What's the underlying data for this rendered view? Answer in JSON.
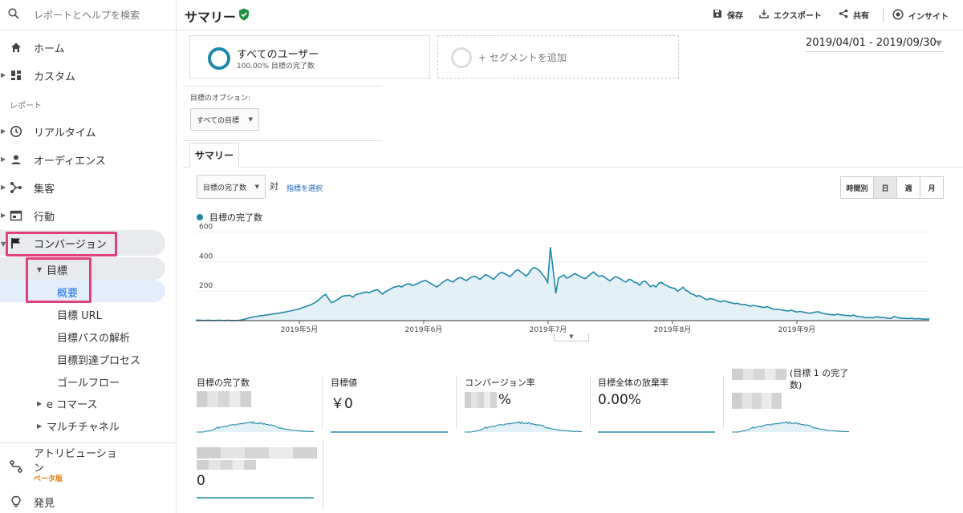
{
  "sidebar": {
    "search_placeholder": "レポートとヘルプを検索",
    "home": "ホーム",
    "custom": "カスタム",
    "reports_section": "レポート",
    "realtime": "リアルタイム",
    "audience": "オーディエンス",
    "acquisition": "集客",
    "behavior": "行動",
    "conversions": "コンバージョン",
    "goals": "目標",
    "overview": "概要",
    "goal_url": "目標 URL",
    "reverse_goal_path": "目標パスの解析",
    "funnel": "目標到達プロセス",
    "goal_flow": "ゴールフロー",
    "ecommerce": "e コマース",
    "multichannel": "マルチチャネル",
    "attribution": "アトリビューション",
    "beta": "ベータ版",
    "discover": "発見"
  },
  "topbar": {
    "title": "サマリー",
    "save": "保存",
    "export": "エクスポート",
    "share": "共有",
    "insights": "インサイト"
  },
  "segments": {
    "all_users": "すべてのユーザー",
    "all_users_sub": "100.00% 目標の完了数",
    "add_segment": "+ セグメントを追加"
  },
  "date_range": "2019/04/01 - 2019/09/30",
  "goal_options": {
    "label": "目標のオプション:",
    "selected": "すべての目標"
  },
  "tab": "サマリー",
  "metric_selector": {
    "selected": "目標の完了数",
    "vs": "対",
    "pick": "指標を選択"
  },
  "time_buttons": [
    "時間別",
    "日",
    "週",
    "月"
  ],
  "active_time": "日",
  "chart_data": {
    "type": "area",
    "series": [
      {
        "name": "目標の完了数",
        "color": "#1e88a8",
        "values": [
          2,
          3,
          2,
          1,
          2,
          2,
          1,
          1,
          2,
          2,
          1,
          1,
          2,
          1,
          1,
          1,
          2,
          5,
          10,
          14,
          20,
          24,
          28,
          30,
          34,
          35,
          38,
          40,
          44,
          46,
          48,
          52,
          55,
          58,
          62,
          66,
          70,
          74,
          78,
          85,
          92,
          98,
          105,
          112,
          122,
          135,
          150,
          168,
          178,
          150,
          122,
          128,
          140,
          150,
          165,
          168,
          170,
          172,
          158,
          175,
          180,
          185,
          190,
          194,
          188,
          198,
          205,
          210,
          196,
          180,
          195,
          205,
          215,
          225,
          230,
          236,
          228,
          240,
          248,
          250,
          238,
          245,
          252,
          262,
          268,
          272,
          260,
          250,
          240,
          228,
          240,
          258,
          270,
          280,
          270,
          262,
          278,
          288,
          292,
          280,
          272,
          285,
          296,
          302,
          292,
          280,
          296,
          312,
          305,
          292,
          280,
          300,
          318,
          328,
          320,
          310,
          298,
          315,
          336,
          346,
          332,
          318,
          302,
          320,
          348,
          360,
          352,
          340,
          315,
          292,
          258,
          498,
          350,
          185,
          290,
          298,
          310,
          288,
          296,
          306,
          320,
          310,
          300,
          290,
          285,
          302,
          318,
          330,
          312,
          300,
          305,
          296,
          282,
          270,
          285,
          298,
          292,
          282,
          268,
          262,
          280,
          275,
          260,
          256,
          240,
          262,
          268,
          250,
          230,
          240,
          228,
          252,
          260,
          246,
          238,
          228,
          222,
          218,
          200,
          212,
          226,
          205,
          198,
          182,
          176,
          165,
          170,
          160,
          148,
          142,
          150,
          146,
          140,
          132,
          128,
          135,
          130,
          124,
          120,
          115,
          118,
          112,
          108,
          110,
          102,
          98,
          104,
          100,
          96,
          92,
          90,
          95,
          88,
          80,
          76,
          78,
          74,
          70,
          68,
          65,
          72,
          64,
          58,
          62,
          60,
          56,
          52,
          50,
          55,
          58,
          60,
          52,
          48,
          45,
          42,
          40,
          38,
          44,
          40,
          38,
          36,
          34,
          32,
          38,
          30,
          28,
          25,
          22,
          20,
          22,
          18,
          24,
          26,
          20,
          22,
          18,
          16,
          15,
          30,
          22,
          18,
          16,
          15,
          14,
          16,
          14,
          12,
          14,
          12,
          10,
          10,
          12
        ],
        "x_ticks": [
          "2019年5月",
          "2019年6月",
          "2019年7月",
          "2019年8月",
          "2019年9月"
        ]
      }
    ],
    "y_ticks": [
      200,
      400,
      600
    ],
    "ylim": [
      0,
      620
    ],
    "grid": true
  },
  "metrics": [
    {
      "title": "目標の完了数",
      "value": ""
    },
    {
      "title": "目標値",
      "value": "￥0"
    },
    {
      "title": "コンバージョン率",
      "value": "%"
    },
    {
      "title": "目標全体の放棄率",
      "value": "0.00%"
    },
    {
      "title": "(目標 1 の完了数)",
      "value": ""
    },
    {
      "title": "",
      "value": "0"
    }
  ],
  "colors": {
    "accent": "#1e88a8",
    "highlight": "#e0407b",
    "link": "#1565c0"
  }
}
